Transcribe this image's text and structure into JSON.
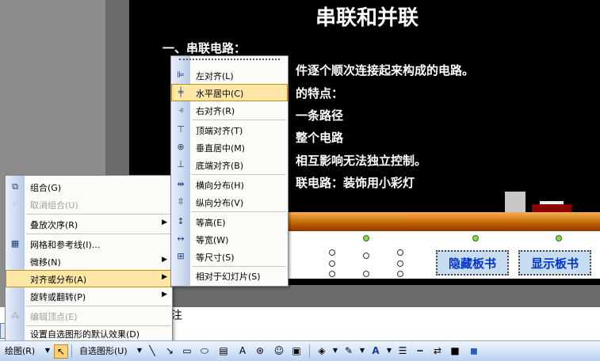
{
  "slide": {
    "title": "串联和并联",
    "lines": [
      "一、串联电路：",
      "件逐个顺次连接起来构成的电路。",
      "的特点：",
      "一条路径",
      "整个电路",
      "相互影响无法独立控制。",
      "联电路：装饰用小彩灯"
    ],
    "buttons": {
      "hide_board": "隐藏板书",
      "show_board": "显示板书"
    }
  },
  "notes": {
    "text": "注"
  },
  "context_menu": {
    "items": [
      {
        "label": "组合(G)",
        "icon": "group-icon",
        "disabled": false,
        "submenu": false
      },
      {
        "label": "取消组合(U)",
        "icon": "ungroup-icon",
        "disabled": true,
        "submenu": false
      },
      {
        "label": "叠放次序(R)",
        "icon": "",
        "disabled": false,
        "submenu": true
      },
      {
        "label": "网格和参考线(I)...",
        "icon": "grid-icon",
        "disabled": false,
        "submenu": false
      },
      {
        "label": "微移(N)",
        "icon": "",
        "disabled": false,
        "submenu": true
      },
      {
        "label": "对齐或分布(A)",
        "icon": "",
        "disabled": false,
        "submenu": true
      },
      {
        "label": "旋转或翻转(P)",
        "icon": "",
        "disabled": false,
        "submenu": true
      },
      {
        "label": "编辑顶点(E)",
        "icon": "edit-points-icon",
        "disabled": true,
        "submenu": false
      },
      {
        "label": "设置自选图形的默认效果(D)",
        "icon": "",
        "disabled": false,
        "submenu": false
      }
    ]
  },
  "align_submenu": {
    "items": [
      {
        "label": "左对齐(L)",
        "icon": "align-left-icon"
      },
      {
        "label": "水平居中(C)",
        "icon": "align-center-icon"
      },
      {
        "label": "右对齐(R)",
        "icon": "align-right-icon"
      },
      {
        "label": "顶端对齐(T)",
        "icon": "align-top-icon"
      },
      {
        "label": "垂直居中(M)",
        "icon": "align-middle-icon"
      },
      {
        "label": "底端对齐(B)",
        "icon": "align-bottom-icon"
      },
      {
        "label": "横向分布(H)",
        "icon": "distribute-horizontal-icon"
      },
      {
        "label": "纵向分布(V)",
        "icon": "distribute-vertical-icon"
      },
      {
        "label": "等高(E)",
        "icon": "same-height-icon"
      },
      {
        "label": "等宽(W)",
        "icon": "same-width-icon"
      },
      {
        "label": "等尺寸(S)",
        "icon": "same-size-icon"
      },
      {
        "label": "相对于幻灯片(S)",
        "icon": ""
      }
    ]
  },
  "toolbar": {
    "draw_label": "绘图(R)",
    "autoshapes_label": "自选图形(U)"
  },
  "colors": {
    "menu_highlight": "#ffe8a6",
    "slide_bg": "#000000",
    "button_text": "#0033cc"
  }
}
